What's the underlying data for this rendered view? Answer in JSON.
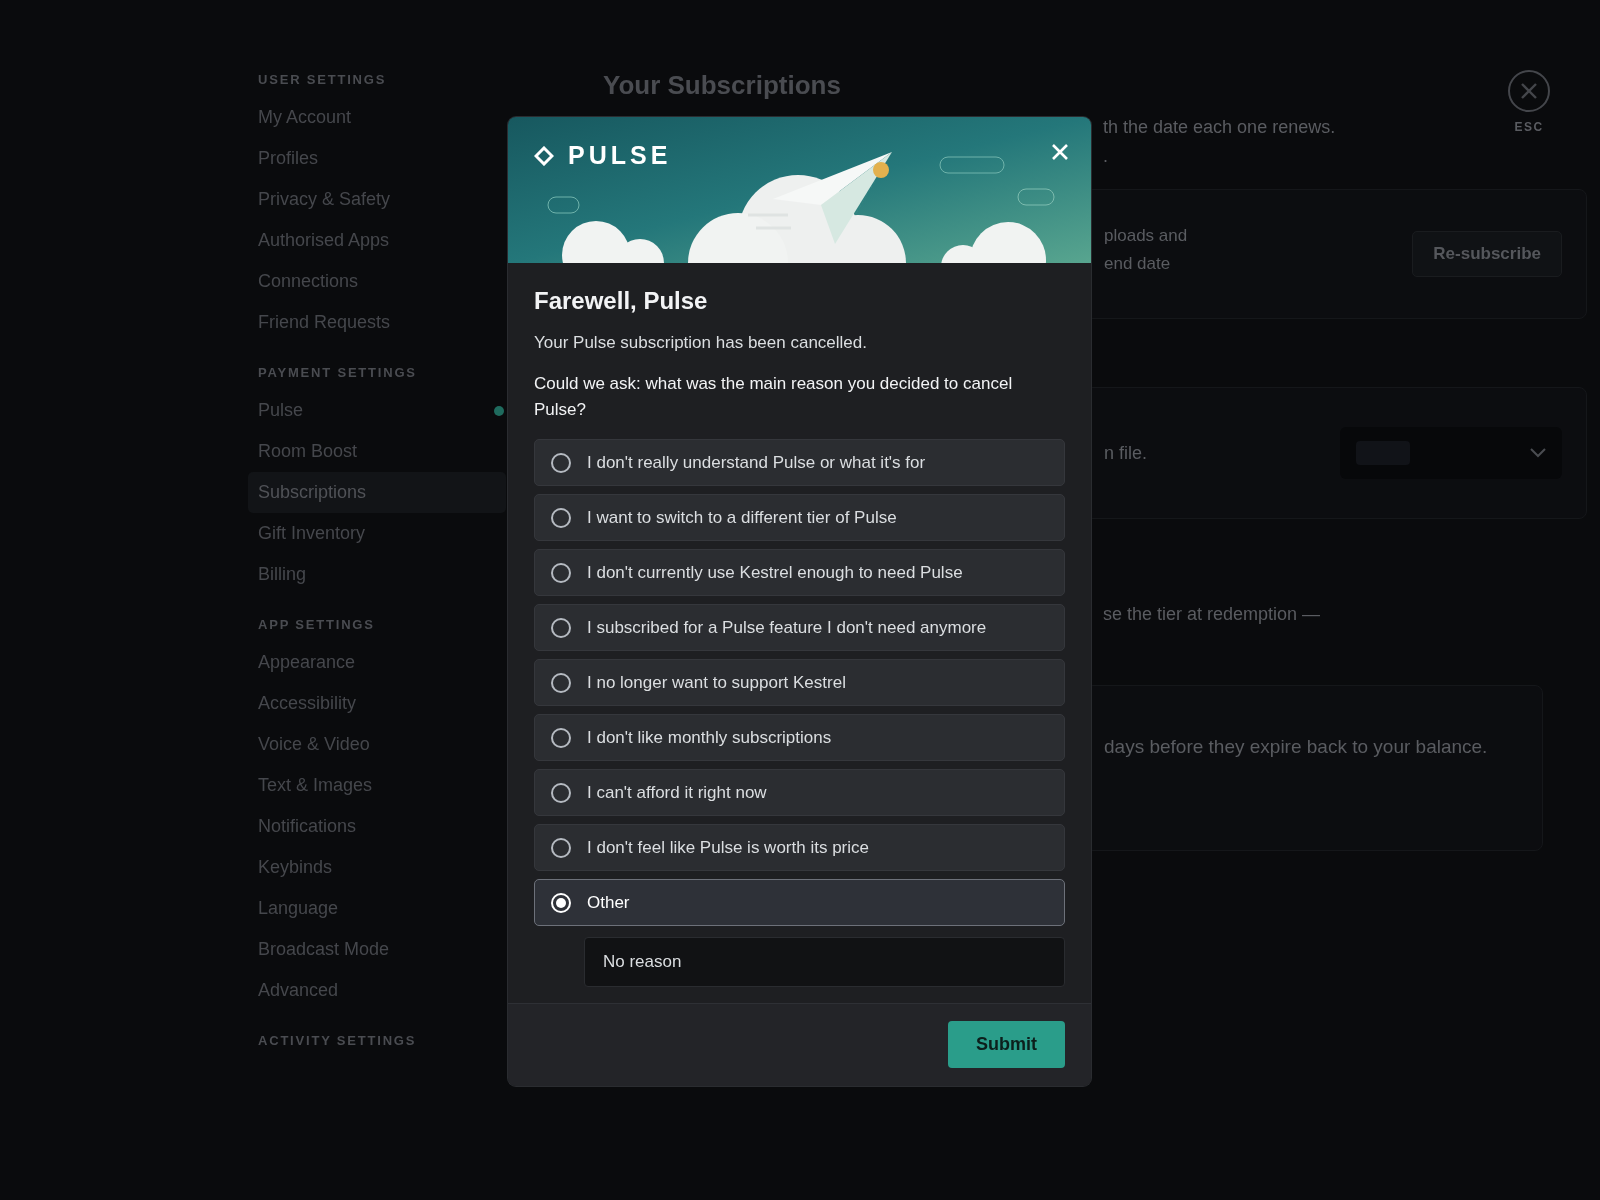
{
  "sidebar": {
    "sections": [
      {
        "heading": "USER SETTINGS",
        "items": [
          {
            "label": "My Account",
            "selected": false
          },
          {
            "label": "Profiles",
            "selected": false
          },
          {
            "label": "Privacy & Safety",
            "selected": false
          },
          {
            "label": "Authorised Apps",
            "selected": false
          },
          {
            "label": "Connections",
            "selected": false
          },
          {
            "label": "Friend Requests",
            "selected": false
          }
        ]
      },
      {
        "heading": "PAYMENT SETTINGS",
        "items": [
          {
            "label": "Pulse",
            "selected": false,
            "dot": true
          },
          {
            "label": "Room Boost",
            "selected": false
          },
          {
            "label": "Subscriptions",
            "selected": true
          },
          {
            "label": "Gift Inventory",
            "selected": false
          },
          {
            "label": "Billing",
            "selected": false
          }
        ]
      },
      {
        "heading": "APP SETTINGS",
        "items": [
          {
            "label": "Appearance",
            "selected": false
          },
          {
            "label": "Accessibility",
            "selected": false
          },
          {
            "label": "Voice & Video",
            "selected": false
          },
          {
            "label": "Text & Images",
            "selected": false
          },
          {
            "label": "Notifications",
            "selected": false
          },
          {
            "label": "Keybinds",
            "selected": false
          },
          {
            "label": "Language",
            "selected": false
          },
          {
            "label": "Broadcast Mode",
            "selected": false
          },
          {
            "label": "Advanced",
            "selected": false
          }
        ]
      },
      {
        "heading": "ACTIVITY SETTINGS"
      }
    ]
  },
  "main": {
    "title": "Your Subscriptions",
    "close_label": "ESC",
    "intro": [
      "th the date each one renews.",
      "."
    ],
    "cancelled_card": {
      "lines": [
        "ploads and",
        "end date"
      ],
      "button": "Re-subscribe"
    },
    "payment_card": {
      "text": "n file."
    },
    "gift_text": "se the tier at redemption —",
    "credits_card": {
      "text": "days before they expire back to your balance."
    }
  },
  "modal": {
    "brand": "PULSE",
    "title": "Farewell, Pulse",
    "message": "Your Pulse subscription has been cancelled.",
    "question": "Could we ask: what was the main reason you decided to cancel Pulse?",
    "reasons": [
      {
        "label": "I don't really understand Pulse or what it's for",
        "selected": false
      },
      {
        "label": "I want to switch to a different tier of Pulse",
        "selected": false
      },
      {
        "label": "I don't currently use Kestrel enough to need Pulse",
        "selected": false
      },
      {
        "label": "I subscribed for a Pulse feature I don't need anymore",
        "selected": false
      },
      {
        "label": "I no longer want to support Kestrel",
        "selected": false
      },
      {
        "label": "I don't like monthly subscriptions",
        "selected": false
      },
      {
        "label": "I can't afford it right now",
        "selected": false
      },
      {
        "label": "I don't feel like Pulse is worth its price",
        "selected": false
      },
      {
        "label": "Other",
        "selected": true
      }
    ],
    "other_reason": {
      "value": "No reason"
    },
    "submit": "Submit"
  }
}
